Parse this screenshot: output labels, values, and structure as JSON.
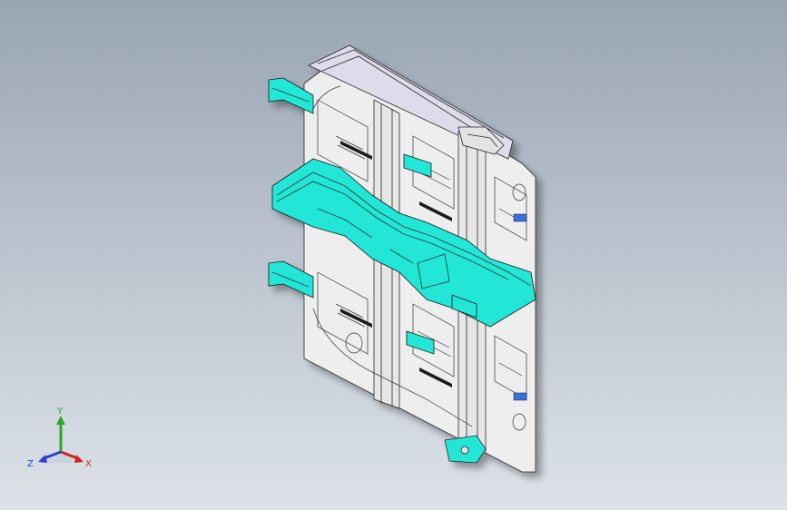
{
  "app": {
    "view": "isometric-3d-viewport"
  },
  "colors": {
    "background_top": "#9aa5b3",
    "background_bottom": "#dde2e8",
    "part_face": "#eeeeee",
    "part_edge": "#2a2a2a",
    "highlight": "#22e6d6",
    "highlight_dark": "#12b8aa",
    "blue_detail": "#3a6fd8",
    "axis_x": "#d32222",
    "axis_y": "#2fa32f",
    "axis_z": "#2a3fd4"
  },
  "triad": {
    "x_label": "X",
    "y_label": "Y",
    "z_label": "Z"
  }
}
